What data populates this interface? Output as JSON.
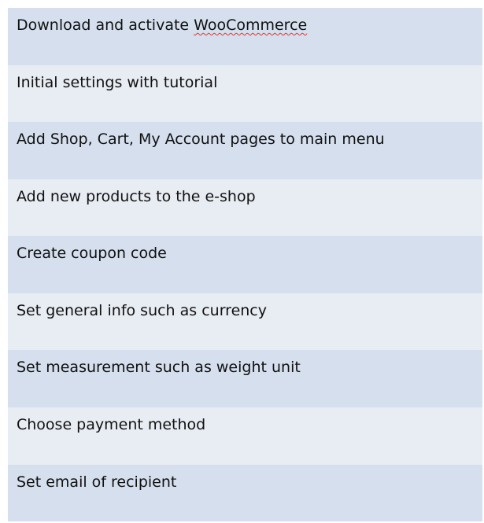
{
  "steps": [
    {
      "prefix": "Download and activate ",
      "flagged": "WooCommerce"
    },
    {
      "text": "Initial settings with tutorial"
    },
    {
      "text": "Add Shop, Cart, My Account pages to main menu"
    },
    {
      "text": "Add new products to the e-shop"
    },
    {
      "text": "Create coupon code"
    },
    {
      "text": "Set general info such as currency"
    },
    {
      "text": "Set measurement such as weight unit"
    },
    {
      "text": "Choose payment method"
    },
    {
      "text": "Set email of recipient"
    }
  ]
}
